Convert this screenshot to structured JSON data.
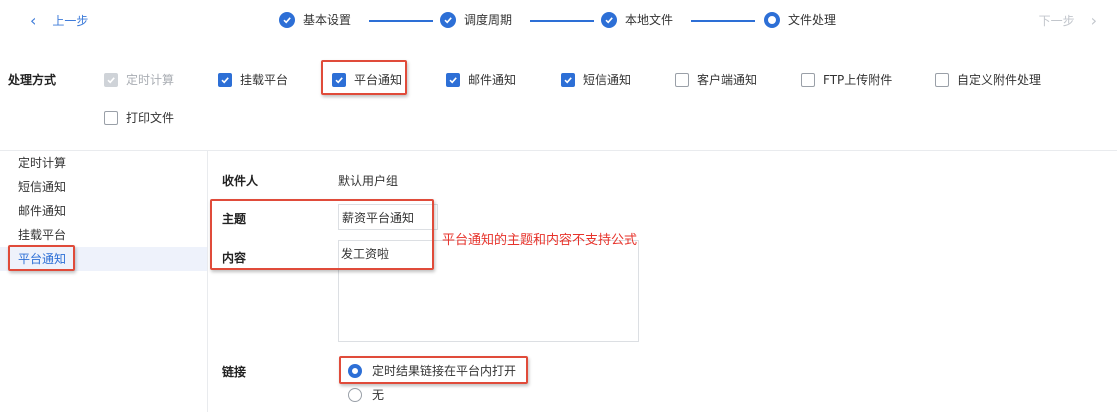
{
  "nav": {
    "prev_label": "上一步",
    "next_label": "下一步",
    "prev_icon": "chevron-left-icon",
    "next_icon": "chevron-right-icon"
  },
  "steps": [
    {
      "label": "基本设置",
      "state": "done"
    },
    {
      "label": "调度周期",
      "state": "done"
    },
    {
      "label": "本地文件",
      "state": "done"
    },
    {
      "label": "文件处理",
      "state": "current"
    }
  ],
  "processing": {
    "label": "处理方式",
    "options": [
      {
        "label": "定时计算",
        "checked": true,
        "disabled": true
      },
      {
        "label": "挂载平台",
        "checked": true
      },
      {
        "label": "平台通知",
        "checked": true
      },
      {
        "label": "邮件通知",
        "checked": true
      },
      {
        "label": "短信通知",
        "checked": true
      },
      {
        "label": "客户端通知",
        "checked": false
      },
      {
        "label": "FTP上传附件",
        "checked": false
      },
      {
        "label": "自定义附件处理",
        "checked": false
      },
      {
        "label": "打印文件",
        "checked": false
      }
    ]
  },
  "sidebar": {
    "items": [
      {
        "label": "定时计算"
      },
      {
        "label": "短信通知"
      },
      {
        "label": "邮件通知"
      },
      {
        "label": "挂载平台"
      },
      {
        "label": "平台通知",
        "active": true
      }
    ]
  },
  "form": {
    "recipient_label": "收件人",
    "recipient_value": "默认用户组",
    "subject_label": "主题",
    "subject_value": "薪资平台通知",
    "content_label": "内容",
    "content_value": "发工资啦",
    "annotation": "平台通知的主题和内容不支持公式",
    "link_label": "链接",
    "link_options": [
      {
        "label": "定时结果链接在平台内打开",
        "selected": true
      },
      {
        "label": "无",
        "selected": false
      }
    ]
  },
  "colors": {
    "accent": "#2d6fd6",
    "highlight_box": "#e04b3a",
    "annotation_text": "#e7332b"
  }
}
